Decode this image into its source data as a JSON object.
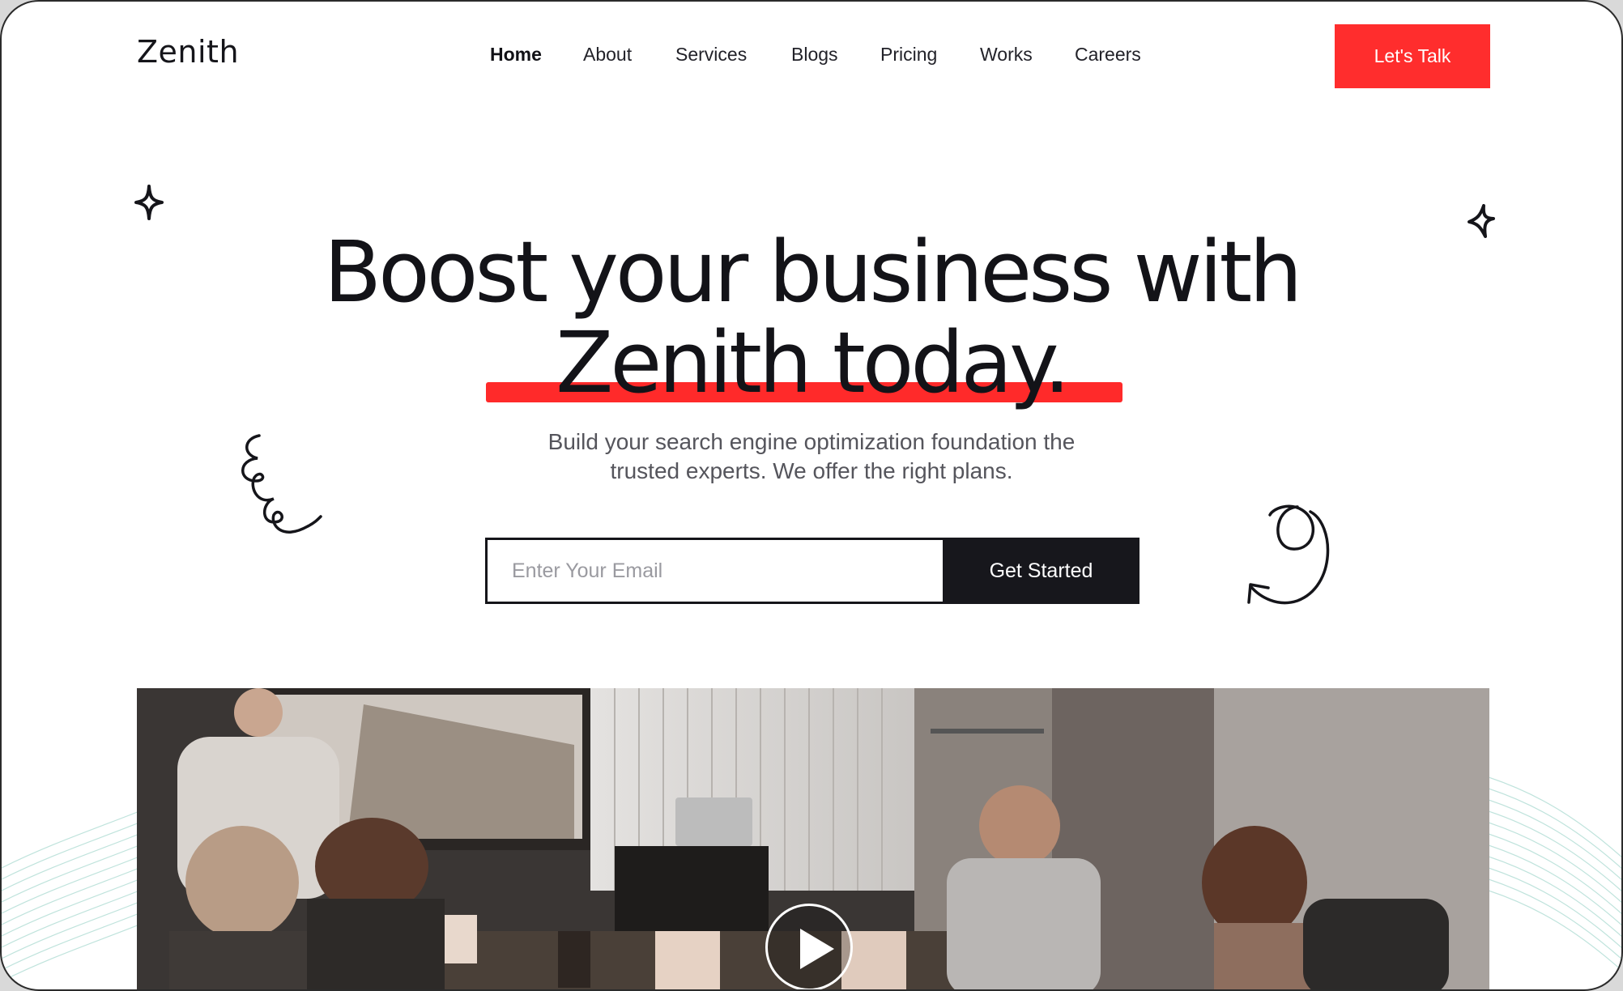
{
  "brand": {
    "logo_text": "Zenith",
    "accent_color": "#FF2D2D",
    "dark_color": "#17171C"
  },
  "nav": {
    "items": [
      {
        "label": "Home",
        "active": true
      },
      {
        "label": "About",
        "active": false
      },
      {
        "label": "Services",
        "active": false
      },
      {
        "label": "Blogs",
        "active": false
      },
      {
        "label": "Pricing",
        "active": false
      },
      {
        "label": "Works",
        "active": false
      },
      {
        "label": "Careers",
        "active": false
      }
    ],
    "cta_label": "Let's Talk"
  },
  "hero": {
    "headline_line1": "Boost your business with",
    "headline_line2": "Zenith today.",
    "subtext_line1": "Build your search engine optimization foundation the",
    "subtext_line2": "trusted experts. We offer the right plans."
  },
  "signup": {
    "email_placeholder": "Enter Your Email",
    "email_value": "",
    "submit_label": "Get Started"
  },
  "video": {
    "icon": "play-icon"
  },
  "decorations": {
    "icons": [
      "sparkle-icon",
      "sparkle-icon",
      "squiggle-icon",
      "loop-arrow-icon"
    ]
  }
}
